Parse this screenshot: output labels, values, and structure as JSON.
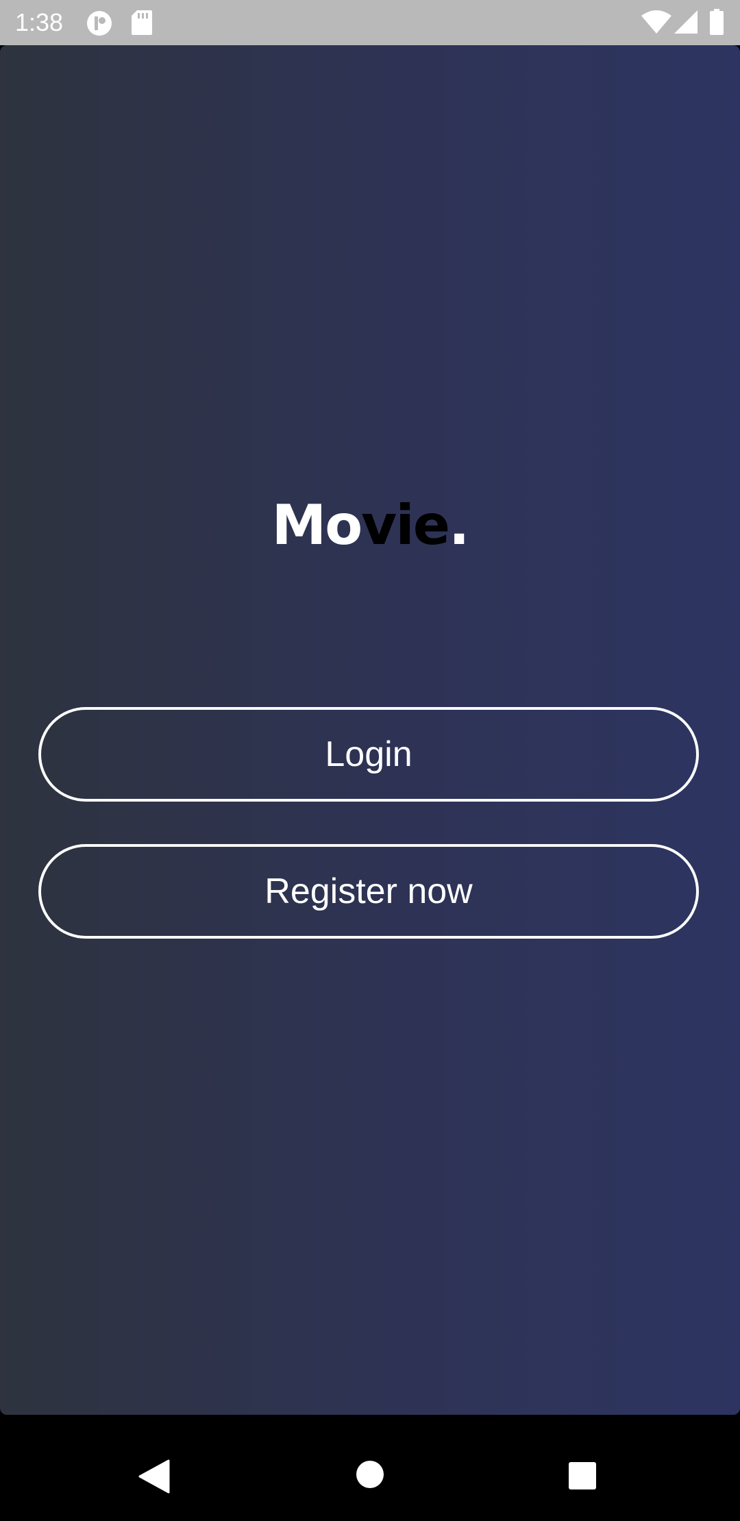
{
  "status_bar": {
    "time": "1:38",
    "icons": [
      "notification-app-icon",
      "sd-card-icon",
      "wifi-icon",
      "signal-icon",
      "battery-icon"
    ]
  },
  "app": {
    "logo": {
      "part1": "Mo",
      "part2": "vie",
      "part3": "."
    },
    "login_label": "Login",
    "register_label": "Register now",
    "colors": {
      "gradient_start": "#2e333f",
      "gradient_end": "#2d3461",
      "button_border": "#ffffff",
      "logo_accent": "#000000"
    }
  },
  "nav_bar": {
    "icons": [
      "back-icon",
      "home-icon",
      "recents-icon"
    ]
  }
}
